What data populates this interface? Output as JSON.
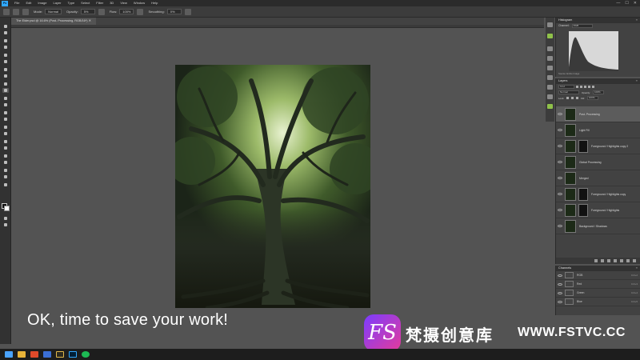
{
  "menubar": {
    "app_logo": "Ps",
    "items": [
      "File",
      "Edit",
      "Image",
      "Layer",
      "Type",
      "Select",
      "Filter",
      "3D",
      "View",
      "Window",
      "Help"
    ],
    "window_controls": [
      "—",
      "☐",
      "✕"
    ]
  },
  "options": {
    "mode_label": "Mode:",
    "mode_value": "Normal",
    "opacity_label": "Opacity:",
    "opacity_value": "5%",
    "flow_label": "Flow:",
    "flow_value": "100%",
    "smoothing_label": "Smoothing:",
    "smoothing_value": "0%"
  },
  "document": {
    "tab_title": "The Elder.psd @ 16.6% (Post- Processing, RGB/16*) ✕"
  },
  "histogram": {
    "title": "Histogram",
    "channel_label": "Channel:",
    "channel_value": "RGB",
    "source_label": "Source:",
    "source_value": "Entire Image",
    "stats": [
      "Mean:",
      "Std Dev:",
      "Median:",
      "Pixels:",
      "Level:",
      "Count:",
      "Percentile:",
      "Cache Level:"
    ]
  },
  "layers": {
    "title": "Layers",
    "kind_label": "Kind",
    "blend_mode": "Normal",
    "opacity_label": "Opacity:",
    "opacity_value": "100%",
    "lock_label": "Lock:",
    "fill_label": "Fill:",
    "fill_value": "100%",
    "items": [
      {
        "name": "Post- Processing",
        "has_mask": false,
        "selected": true
      },
      {
        "name": "Light Fill",
        "has_mask": false,
        "selected": false
      },
      {
        "name": "Foreground / Highlights copy 2",
        "has_mask": true,
        "selected": false
      },
      {
        "name": "Global Processing",
        "has_mask": false,
        "selected": false
      },
      {
        "name": "Merged",
        "has_mask": false,
        "selected": false
      },
      {
        "name": "Foreground / Highlights copy",
        "has_mask": true,
        "selected": false
      },
      {
        "name": "Foreground / Highlights",
        "has_mask": true,
        "selected": false
      },
      {
        "name": "Background / Shadows",
        "has_mask": false,
        "selected": false
      }
    ]
  },
  "channels": {
    "title": "Channels",
    "items": [
      {
        "name": "RGB",
        "key": "Ctrl+2"
      },
      {
        "name": "Red",
        "key": "Ctrl+3"
      },
      {
        "name": "Green",
        "key": "Ctrl+4"
      },
      {
        "name": "Blue",
        "key": "Ctrl+5"
      }
    ]
  },
  "caption": {
    "text": "OK, time to save your work!"
  },
  "watermark": {
    "logo": "FS",
    "chinese": "梵摄创意库",
    "site": "WWW.FSTVC.CC"
  },
  "colors": {
    "accent": "#31a8ff",
    "active_panel_icon": "#8fc14a",
    "watermark_gradient_start": "#7b3cff",
    "watermark_gradient_end": "#e43b9b"
  }
}
